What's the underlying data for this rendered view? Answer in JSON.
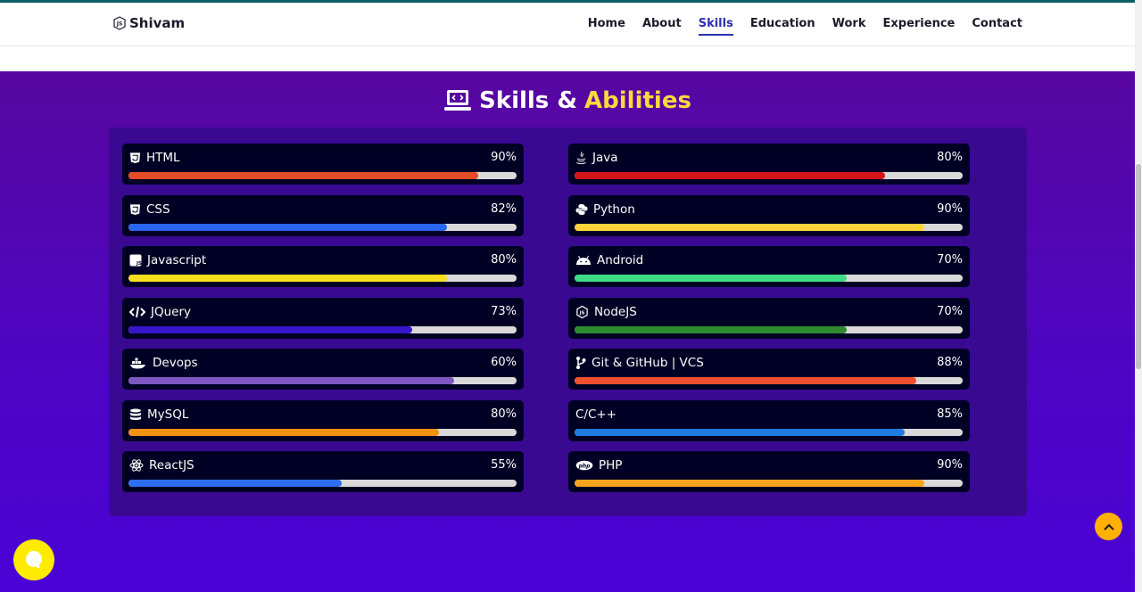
{
  "brand": {
    "name": "Shivam",
    "icon": "js-shield-icon"
  },
  "nav": {
    "items": [
      {
        "label": "Home",
        "active": false
      },
      {
        "label": "About",
        "active": false
      },
      {
        "label": "Skills",
        "active": true
      },
      {
        "label": "Education",
        "active": false
      },
      {
        "label": "Work",
        "active": false
      },
      {
        "label": "Experience",
        "active": false
      },
      {
        "label": "Contact",
        "active": false
      }
    ]
  },
  "section": {
    "title_main": "Skills &",
    "title_highlight": "Abilities",
    "icon": "laptop-code-icon"
  },
  "skills_left": [
    {
      "name": "HTML",
      "percent": "90%",
      "level": 0.9,
      "color": "#e34c26",
      "icon": "html5-icon"
    },
    {
      "name": "CSS",
      "percent": "82%",
      "level": 0.82,
      "color": "#2965f1",
      "icon": "css3-icon"
    },
    {
      "name": "Javascript",
      "percent": "80%",
      "level": 0.82,
      "color": "#f7df1e",
      "icon": "js-square-icon"
    },
    {
      "name": "JQuery",
      "percent": "73%",
      "level": 0.73,
      "color": "#3715c9",
      "icon": "code-icon"
    },
    {
      "name": "Devops",
      "percent": "60%",
      "level": 0.84,
      "color": "#7e57c2",
      "icon": "docker-icon"
    },
    {
      "name": "MySQL",
      "percent": "80%",
      "level": 0.8,
      "color": "#f29111",
      "icon": "database-icon"
    },
    {
      "name": "ReactJS",
      "percent": "55%",
      "level": 0.55,
      "color": "#2f6df0",
      "icon": "react-icon"
    }
  ],
  "skills_right": [
    {
      "name": "Java",
      "percent": "80%",
      "level": 0.8,
      "color": "#d3151a",
      "icon": "java-icon"
    },
    {
      "name": "Python",
      "percent": "90%",
      "level": 0.9,
      "color": "#ffd43b",
      "icon": "python-icon"
    },
    {
      "name": "Android",
      "percent": "70%",
      "level": 0.7,
      "color": "#3ddc84",
      "icon": "android-icon"
    },
    {
      "name": "NodeJS",
      "percent": "70%",
      "level": 0.7,
      "color": "#2e8b2e",
      "icon": "nodejs-icon"
    },
    {
      "name": "Git & GitHub | VCS",
      "percent": "88%",
      "level": 0.88,
      "color": "#f1502f",
      "icon": "git-branch-icon"
    },
    {
      "name": "C/C++",
      "percent": "85%",
      "level": 0.85,
      "color": "#1e7be0",
      "icon": ""
    },
    {
      "name": "PHP",
      "percent": "90%",
      "level": 0.9,
      "color": "#f7a41d",
      "icon": "php-icon"
    }
  ],
  "colors": {
    "accent": "#ffd83c",
    "nav_active": "#2a2fb0",
    "scroll_top": "#ffb000",
    "chat": "#ffeb00"
  }
}
